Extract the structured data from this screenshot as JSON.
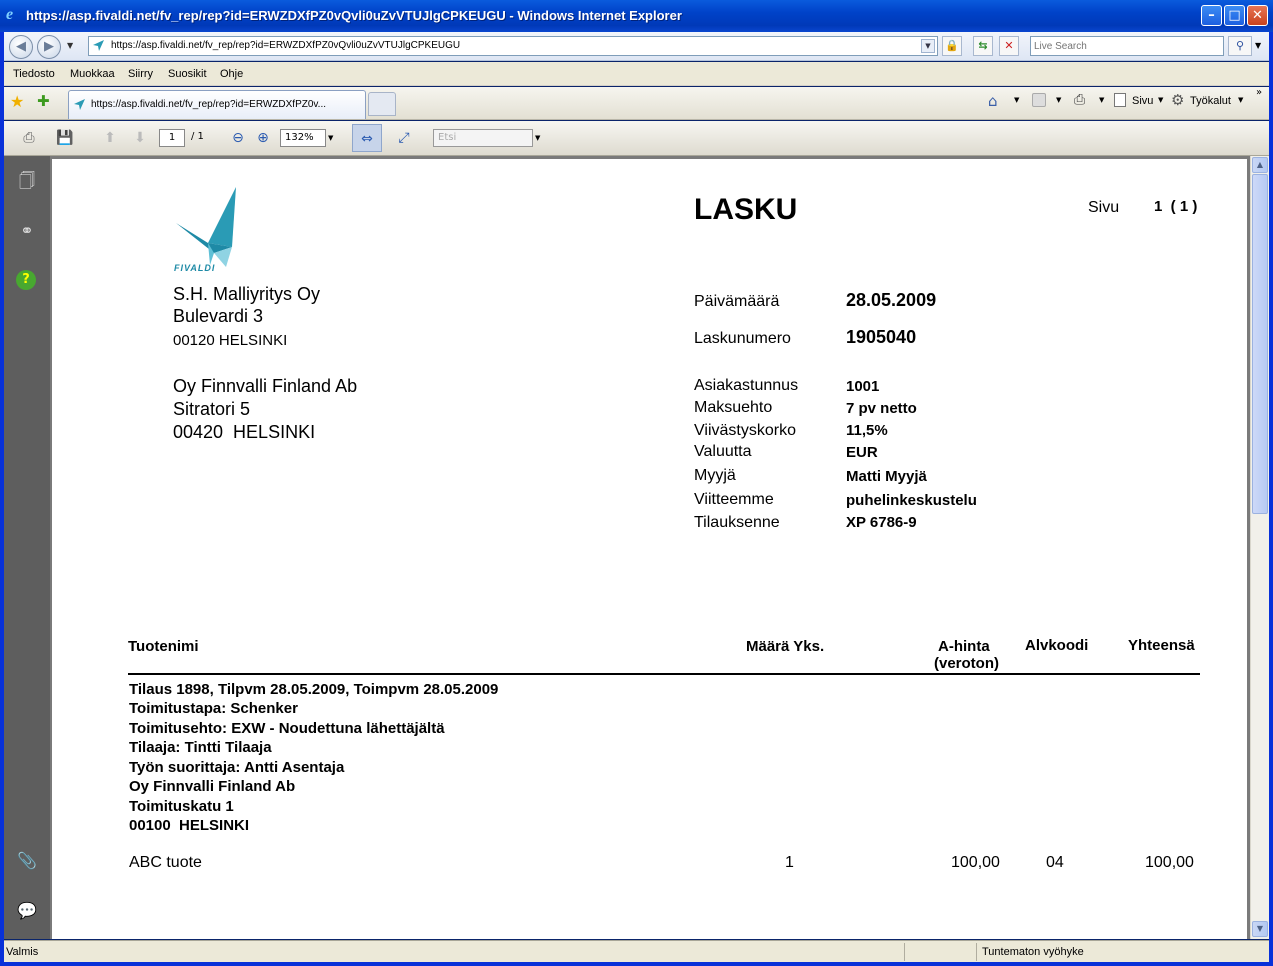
{
  "window": {
    "title": "https://asp.fivaldi.net/fv_rep/rep?id=ERWZDXfPZ0vQvli0uZvVTUJlgCPKEUGU - Windows Internet Explorer"
  },
  "address": {
    "url": "https://asp.fivaldi.net/fv_rep/rep?id=ERWZDXfPZ0vQvli0uZvVTUJlgCPKEUGU",
    "search_placeholder": "Live Search"
  },
  "menu": [
    "Tiedosto",
    "Muokkaa",
    "Siirry",
    "Suosikit",
    "Ohje"
  ],
  "tab": {
    "label": "https://asp.fivaldi.net/fv_rep/rep?id=ERWZDXfPZ0v..."
  },
  "commandbar": {
    "page_label": "Sivu",
    "tools_label": "Työkalut"
  },
  "pdf_toolbar": {
    "page_current": "1",
    "page_total": "/ 1",
    "zoom": "132%",
    "find_placeholder": "Etsi"
  },
  "invoice": {
    "logo_text": "FIVALDI",
    "title": "LASKU",
    "page_label": "Sivu",
    "page_value": "1  ( 1 )",
    "sender": {
      "name": "S.H. Malliyritys Oy",
      "street": "Bulevardi 3",
      "city": "00120 HELSINKI"
    },
    "recipient": {
      "name": "Oy Finnvalli Finland Ab",
      "street": "Sitratori 5",
      "city": "00420  HELSINKI"
    },
    "date_label": "Päivämäärä",
    "date_value": "28.05.2009",
    "number_label": "Laskunumero",
    "number_value": "1905040",
    "details": [
      {
        "label": "Asiakastunnus",
        "value": "1001"
      },
      {
        "label": "Maksuehto",
        "value": "7 pv netto"
      },
      {
        "label": "Viivästyskorko",
        "value": "11,5%"
      },
      {
        "label": "Valuutta",
        "value": "EUR"
      },
      {
        "label": "Myyjä",
        "value": "Matti Myyjä"
      },
      {
        "label": "Viitteemme",
        "value": "puhelinkeskustelu"
      },
      {
        "label": "Tilauksenne",
        "value": "XP 6786-9"
      }
    ],
    "columns": {
      "product": "Tuotenimi",
      "qty_unit": "Määrä Yks.",
      "unit_price": "A-hinta",
      "unit_price_sub": "(veroton)",
      "vat_code": "Alvkoodi",
      "total": "Yhteensä"
    },
    "order_lines": [
      "Tilaus 1898, Tilpvm 28.05.2009, Toimpvm 28.05.2009",
      "Toimitustapa: Schenker",
      "Toimitusehto: EXW - Noudettuna lähettäjältä",
      "Tilaaja: Tintti Tilaaja",
      "Työn suorittaja: Antti Asentaja",
      "Oy Finnvalli Finland Ab",
      "Toimituskatu 1",
      "00100  HELSINKI"
    ],
    "rows": [
      {
        "product": "ABC tuote",
        "qty": "1",
        "price": "100,00",
        "vat": "04",
        "total": "100,00"
      }
    ]
  },
  "status": {
    "left": "Valmis",
    "zone": "Tuntematon vyöhyke"
  },
  "colors": {
    "title_bar": "#0042c8",
    "chrome": "#ece9d8",
    "pdf_nav": "#5e5e5e",
    "logo_teal": "#2a9bb5"
  }
}
